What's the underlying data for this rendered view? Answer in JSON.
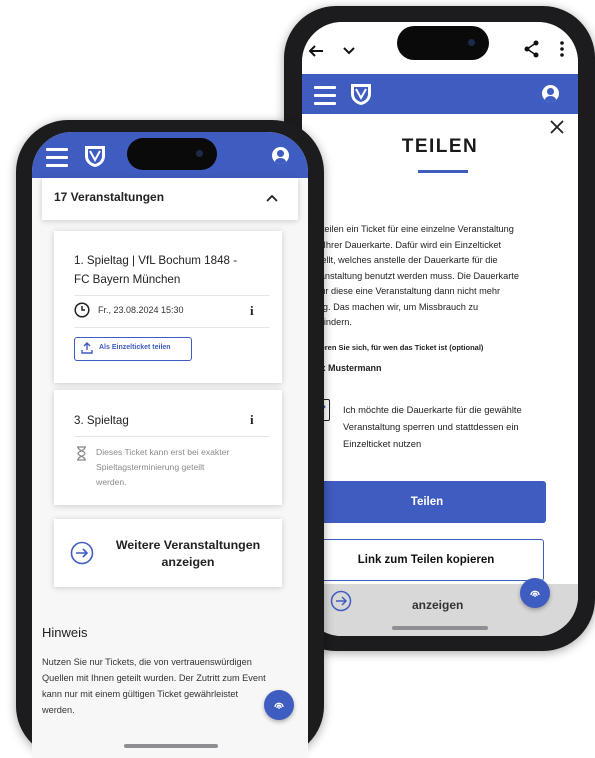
{
  "left_phone": {
    "events_header": "17 Veranstaltungen",
    "event1": {
      "title_line1": "1. Spieltag | VfL Bochum 1848 -",
      "title_line2": "FC Bayern München",
      "datetime": "Fr., 23.08.2024 15:30",
      "info_glyph": "i",
      "share_button": "Als Einzelticket teilen"
    },
    "event2": {
      "title": "3. Spieltag",
      "info_glyph": "i",
      "note_line1": "Dieses Ticket kann erst bei exakter",
      "note_line2": "Spieltagsterminierung geteilt",
      "note_line3": "werden."
    },
    "more_button_line1": "Weitere Veranstaltungen",
    "more_button_line2": "anzeigen",
    "hint_title": "Hinweis",
    "hint_lines": [
      "Nutzen Sie nur Tickets, die von vertrauenswürdigen",
      "Quellen mit Ihnen geteilt wurden. Der Zutritt zum Event",
      "kann nur mit einem gültigen Ticket gewährleistet",
      "werden."
    ]
  },
  "right_phone": {
    "dialog_title": "TEILEN",
    "body_lines": [
      "Sie teilen ein Ticket für eine einzelne Veranstaltung",
      "aus Ihrer Dauerkarte. Dafür wird ein Einzelticket",
      "erstellt, welches anstelle der Dauerkarte für die",
      "Veranstaltung benutzt werden muss. Die Dauerkarte",
      "ist für diese eine Veranstaltung dann nicht mehr",
      "gültig. Das machen wir, um Missbrauch zu",
      "verhindern."
    ],
    "note_label": "Notieren Sie sich, für wen das Ticket ist (optional)",
    "note_value": "Max Mustermann",
    "checkbox_checked": true,
    "checkbox_lines": [
      "Ich möchte die Dauerkarte für die gewählte",
      "Veranstaltung sperren und stattdessen ein",
      "Einzelticket nutzen"
    ],
    "share_button": "Teilen",
    "copy_link_button": "Link zum Teilen kopieren",
    "behind_text": "anzeigen"
  },
  "icons": {
    "back": "arrow-left-icon",
    "chevron": "chevron-down-icon",
    "share": "share-icon",
    "more": "more-vertical-icon",
    "menu": "hamburger-menu-icon",
    "crest": "club-crest-logo",
    "profile": "user-profile-icon",
    "close": "close-icon",
    "collapse": "chevron-up-icon",
    "clock": "clock-icon",
    "info": "info-icon",
    "share_upload": "share-upload-icon",
    "hourglass": "hourglass-icon",
    "arrow_circle": "arrow-right-circle-icon",
    "fingerprint": "fingerprint-icon",
    "checkmark": "checkmark-icon"
  },
  "colors": {
    "brand_blue": "#3f5cc0",
    "dark_text": "#222222",
    "muted_text": "#8a8a8a"
  }
}
